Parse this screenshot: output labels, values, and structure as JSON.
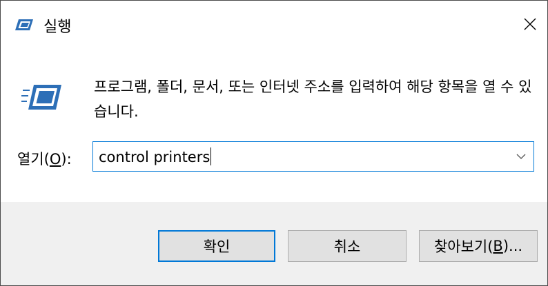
{
  "window": {
    "title": "실행",
    "icon": "run-icon",
    "close_icon": "close-icon"
  },
  "dialog": {
    "description": "프로그램, 폴더, 문서, 또는 인터넷 주소를 입력하여 해당 항목을 열 수 있습니다.",
    "icon": "run-icon"
  },
  "open_field": {
    "label_prefix": "열기(",
    "label_accel": "O",
    "label_suffix": "):",
    "value": "control printers",
    "dropdown_icon": "chevron-down-icon"
  },
  "buttons": {
    "ok": "확인",
    "cancel": "취소",
    "browse_prefix": "찾아보기(",
    "browse_accel": "B",
    "browse_suffix": ")..."
  },
  "colors": {
    "accent": "#0078d7",
    "footer_bg": "#f0f0f0",
    "button_bg": "#e1e1e1",
    "icon_blue": "#2d6fb7"
  }
}
